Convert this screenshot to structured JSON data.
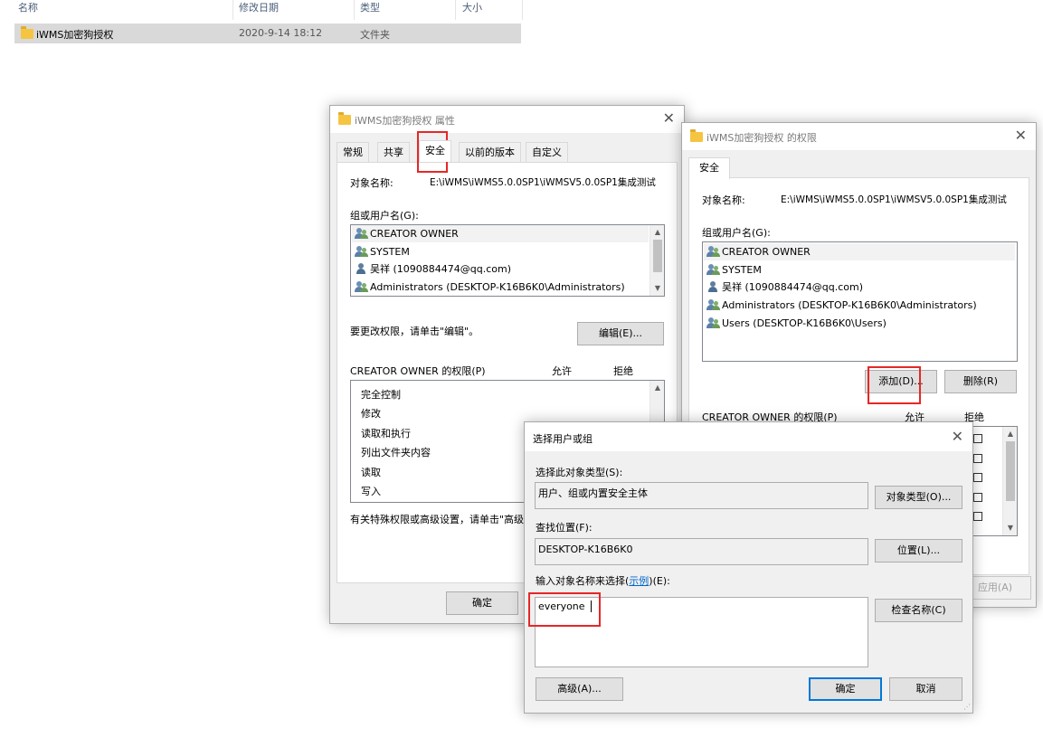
{
  "explorer": {
    "columns": {
      "name": "名称",
      "modified": "修改日期",
      "type": "类型",
      "size": "大小"
    },
    "row": {
      "name": "iWMS加密狗授权",
      "modified": "2020-9-14 18:12",
      "type": "文件夹"
    }
  },
  "props": {
    "title": "iWMS加密狗授权 属性",
    "tabs": [
      "常规",
      "共享",
      "安全",
      "以前的版本",
      "自定义"
    ],
    "object_label": "对象名称:",
    "object_value": "E:\\iWMS\\iWMS5.0.0SP1\\iWMSV5.0.0SP1集成测试",
    "group_label": "组或用户名(G):",
    "users": [
      "CREATOR OWNER",
      "SYSTEM",
      "吴祥 (1090884474@qq.com)",
      "Administrators (DESKTOP-K16B6K0\\Administrators)"
    ],
    "change_hint": "要更改权限，请单击\"编辑\"。",
    "edit_btn": "编辑(E)...",
    "perm_label": "CREATOR OWNER 的权限(P)",
    "allow": "允许",
    "deny": "拒绝",
    "perms": [
      "完全控制",
      "修改",
      "读取和执行",
      "列出文件夹内容",
      "读取",
      "写入"
    ],
    "special_hint": "有关特殊权限或高级设置，请单击\"高级",
    "ok_btn": "确定"
  },
  "perm_dialog": {
    "title": "iWMS加密狗授权 的权限",
    "tab": "安全",
    "object_label": "对象名称:",
    "object_value": "E:\\iWMS\\iWMS5.0.0SP1\\iWMSV5.0.0SP1集成测试",
    "group_label": "组或用户名(G):",
    "users": [
      "CREATOR OWNER",
      "SYSTEM",
      "吴祥 (1090884474@qq.com)",
      "Administrators (DESKTOP-K16B6K0\\Administrators)",
      "Users (DESKTOP-K16B6K0\\Users)"
    ],
    "add_btn": "添加(D)...",
    "remove_btn": "删除(R)",
    "perm_label": "CREATOR OWNER 的权限(P)",
    "allow": "允许",
    "deny": "拒绝",
    "apply_btn": "应用(A)"
  },
  "select_dialog": {
    "title": "选择用户或组",
    "type_label": "选择此对象类型(S):",
    "type_value": "用户、组或内置安全主体",
    "type_btn": "对象类型(O)...",
    "loc_label": "查找位置(F):",
    "loc_value": "DESKTOP-K16B6K0",
    "loc_btn": "位置(L)...",
    "enter_label_a": "输入对象名称来选择(",
    "enter_link": "示例",
    "enter_label_b": ")(E):",
    "input_value": "everyone",
    "check_btn": "检查名称(C)",
    "advanced_btn": "高级(A)...",
    "ok_btn": "确定",
    "cancel_btn": "取消"
  }
}
